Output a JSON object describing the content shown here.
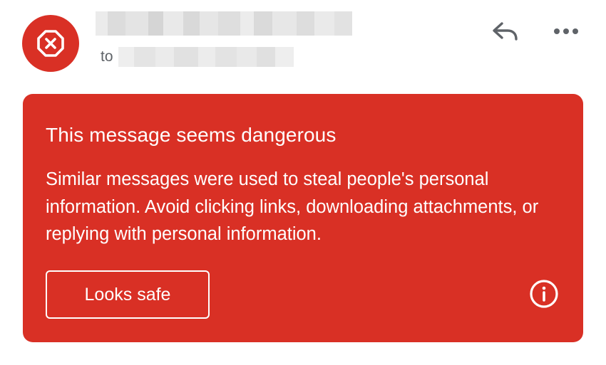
{
  "header": {
    "avatar_icon": "blocked-x-octagon-icon",
    "sender": "",
    "to_label": "to",
    "recipient": "",
    "reply_icon": "reply-icon",
    "more_icon": "more-horizontal-icon"
  },
  "warning": {
    "title": "This message seems dangerous",
    "body": "Similar messages were used to steal people's personal information. Avoid clicking links, downloading attachments, or replying with personal information.",
    "looks_safe_label": "Looks safe",
    "info_icon": "info-icon",
    "background_color": "#d93025",
    "text_color": "#ffffff"
  }
}
